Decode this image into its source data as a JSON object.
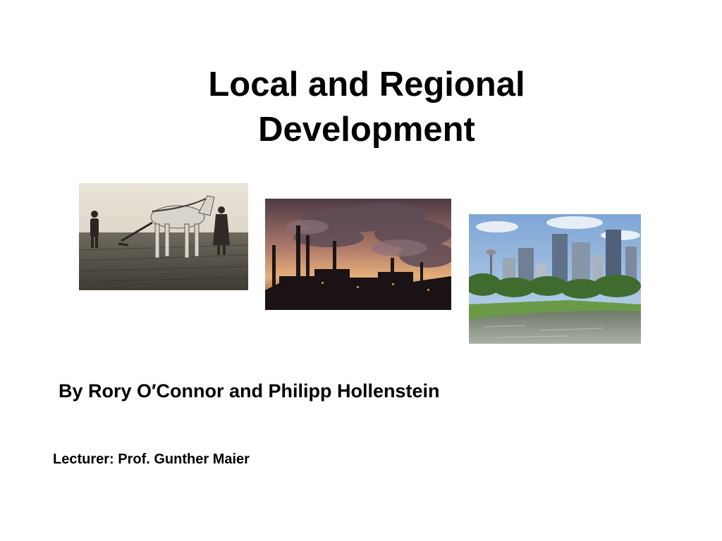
{
  "slide": {
    "title_line1": "Local and Regional",
    "title_line2": "Development",
    "authors": "By Rory O′Connor and Philipp Hollenstein",
    "lecturer": "Lecturer: Prof. Gunther Maier"
  },
  "images": [
    {
      "name": "farming-photo",
      "description_icon": "horse-plough-photo"
    },
    {
      "name": "industry-photo",
      "description_icon": "smokestack-factory-photo"
    },
    {
      "name": "city-photo",
      "description_icon": "city-skyline-park-photo"
    }
  ],
  "colors": {
    "background": "#ffffff",
    "text": "#000000"
  }
}
